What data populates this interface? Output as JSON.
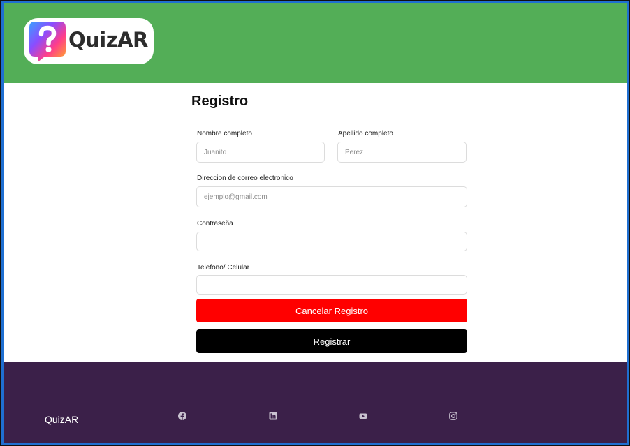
{
  "header": {
    "logo_text": "QuizAR",
    "logo_icon": "question-bubble-icon",
    "colors": {
      "header_bg": "#53ae57"
    }
  },
  "form": {
    "title": "Registro",
    "fields": {
      "first_name": {
        "label": "Nombre completo",
        "placeholder": "Juanito",
        "value": ""
      },
      "last_name": {
        "label": "Apellido completo",
        "placeholder": "Perez",
        "value": ""
      },
      "email": {
        "label": "Direccion de correo electronico",
        "placeholder": "ejemplo@gmail.com",
        "value": ""
      },
      "password": {
        "label": "Contraseña",
        "placeholder": "",
        "value": ""
      },
      "phone": {
        "label": "Telefono/ Celular",
        "placeholder": "",
        "value": ""
      }
    },
    "buttons": {
      "cancel_label": "Cancelar Registro",
      "register_label": "Registrar"
    },
    "colors": {
      "cancel": "#ff0000",
      "register": "#000000"
    }
  },
  "footer": {
    "brand": "QuizAR",
    "social_icons": [
      "facebook-icon",
      "linkedin-icon",
      "youtube-icon",
      "instagram-icon"
    ],
    "colors": {
      "footer_bg": "#3b2049"
    }
  }
}
